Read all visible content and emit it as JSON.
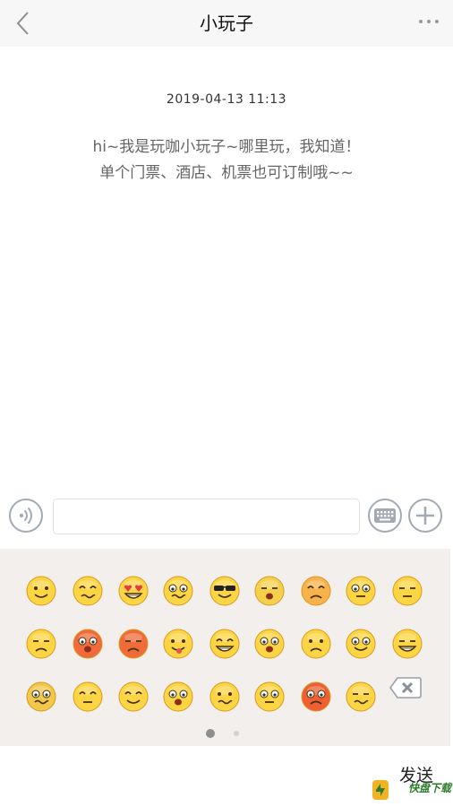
{
  "header": {
    "title": "小玩子",
    "back_icon": "chevron-left-icon",
    "more_icon": "more-dots-icon"
  },
  "chat": {
    "timestamp": "2019-04-13  11:13",
    "message_lines": [
      "hi~我是玩咖小玩子~哪里玩，我知道！",
      "单个门票、酒店、机票也可订制哦~~"
    ]
  },
  "input_bar": {
    "voice_icon": "voice-icon",
    "text_value": "",
    "keyboard_icon": "keyboard-icon",
    "plus_icon": "plus-icon"
  },
  "emoji_panel": {
    "emoji_names": [
      [
        "smile",
        "woozy",
        "heart-eyes",
        "confused",
        "sunglasses",
        "crying",
        "blush-angry",
        "speechless",
        "sleepy"
      ],
      [
        "sweat",
        "embarrassed",
        "angry",
        "tongue",
        "grin",
        "shocked",
        "sad",
        "starry-eyes",
        "laugh-cry"
      ],
      [
        "nauseous",
        "cover-mouth",
        "shy",
        "surprised",
        "thinking",
        "eye-roll",
        "furious",
        "sneer"
      ]
    ],
    "delete_icon": "backspace-icon",
    "page_count": 2,
    "current_page": 1
  },
  "footer": {
    "send_label": "发送",
    "watermark_text": "快盘下载"
  },
  "colors": {
    "nav_bg": "#f7f7f7",
    "panel_bg": "#f3efed",
    "icon_gray": "#a3aab4",
    "emoji_yellow": "#fcd544"
  }
}
